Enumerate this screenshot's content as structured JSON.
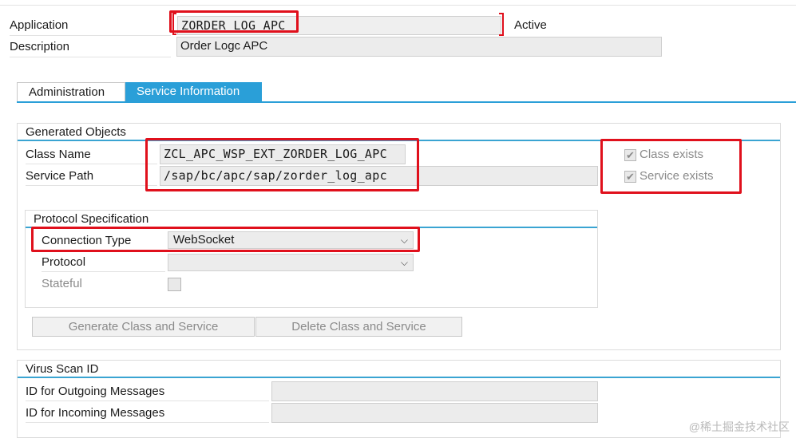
{
  "header": {
    "application_label": "Application",
    "application_value": "ZORDER_LOG_APC",
    "status": "Active",
    "description_label": "Description",
    "description_value": "Order Logc APC"
  },
  "tabs": [
    {
      "label": "Administration",
      "active": false
    },
    {
      "label": "Service Information",
      "active": true
    }
  ],
  "generated_objects": {
    "title": "Generated Objects",
    "class_name_label": "Class Name",
    "class_name_value": "ZCL_APC_WSP_EXT_ZORDER_LOG_APC",
    "service_path_label": "Service Path",
    "service_path_value": "/sap/bc/apc/sap/zorder_log_apc",
    "class_exists_label": "Class exists",
    "class_exists_checked": true,
    "service_exists_label": "Service exists",
    "service_exists_checked": true
  },
  "protocol_specification": {
    "title": "Protocol Specification",
    "connection_type_label": "Connection Type",
    "connection_type_value": "WebSocket",
    "protocol_label": "Protocol",
    "protocol_value": "",
    "stateful_label": "Stateful",
    "stateful_checked": false
  },
  "buttons": {
    "generate": "Generate Class and Service",
    "delete": "Delete Class and Service"
  },
  "virus_scan": {
    "title": "Virus Scan ID",
    "outgoing_label": "ID for Outgoing Messages",
    "outgoing_value": "",
    "incoming_label": "ID for Incoming Messages",
    "incoming_value": ""
  },
  "watermark": "@稀土掘金技术社区",
  "colors": {
    "accent": "#2a9fd8",
    "highlight_box": "#e0101c",
    "field_bg": "#ececec"
  }
}
